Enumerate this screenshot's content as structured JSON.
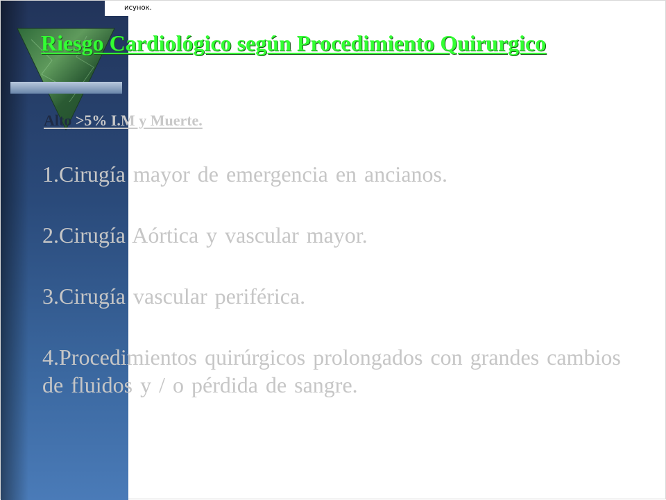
{
  "caption": "исунок.",
  "title": "Riesgo Cardiológico según Procedimiento Quirurgico",
  "subhead": {
    "prefix": "Alto",
    "rest": " >5% I.M y Muerte."
  },
  "items": [
    "1.Cirugía  mayor de emergencia en ancianos.",
    "2.Cirugía  Aórtica  y vascular mayor.",
    "3.Cirugía vascular periférica.",
    "4.Procedimientos quirúrgicos prolongados con grandes cambios de fluidos y / o pérdida de sangre."
  ],
  "colors": {
    "title": "#33ff33",
    "body_text": "#c6c6c6",
    "sidebar": "#2a4a7a"
  }
}
